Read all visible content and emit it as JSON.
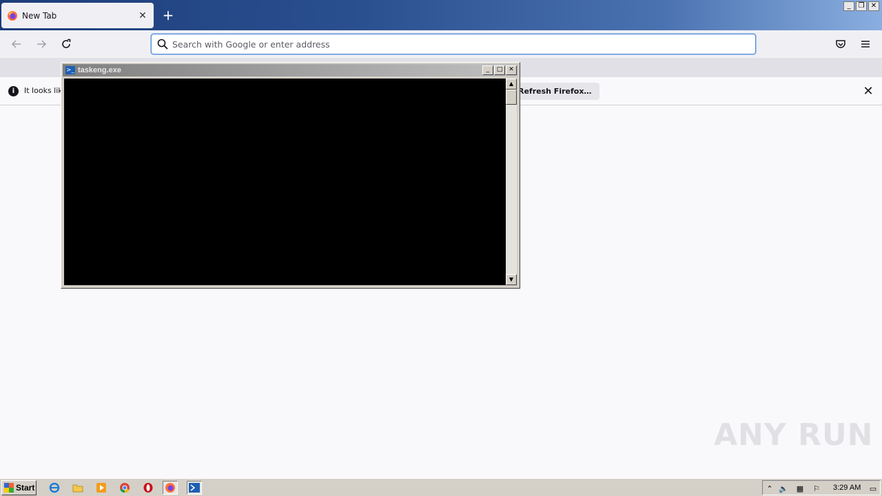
{
  "browser": {
    "tab": {
      "title": "New Tab",
      "close_glyph": "✕"
    },
    "new_tab_glyph": "+",
    "window_controls": [
      "_",
      "❐",
      "✕"
    ],
    "urlbar": {
      "placeholder": "Search with Google or enter address",
      "value": ""
    },
    "notification": {
      "message": "It looks like",
      "refresh_button": "Refresh Firefox…",
      "close_glyph": "✕"
    }
  },
  "console_window": {
    "title": "taskeng.exe",
    "buttons": [
      "_",
      "□",
      "✕"
    ]
  },
  "watermark": {
    "text": "ANY RUN"
  },
  "taskbar": {
    "start_label": "Start",
    "clock": "3:29 AM",
    "pinned": [
      "internet-explorer-icon",
      "folder-icon",
      "media-player-icon",
      "chrome-icon",
      "opera-icon",
      "firefox-icon",
      "powershell-icon"
    ]
  },
  "colors": {
    "accent": "#5b8dd6",
    "tabstrip_dark": "#1d3d7a",
    "console_bg": "#000000"
  }
}
